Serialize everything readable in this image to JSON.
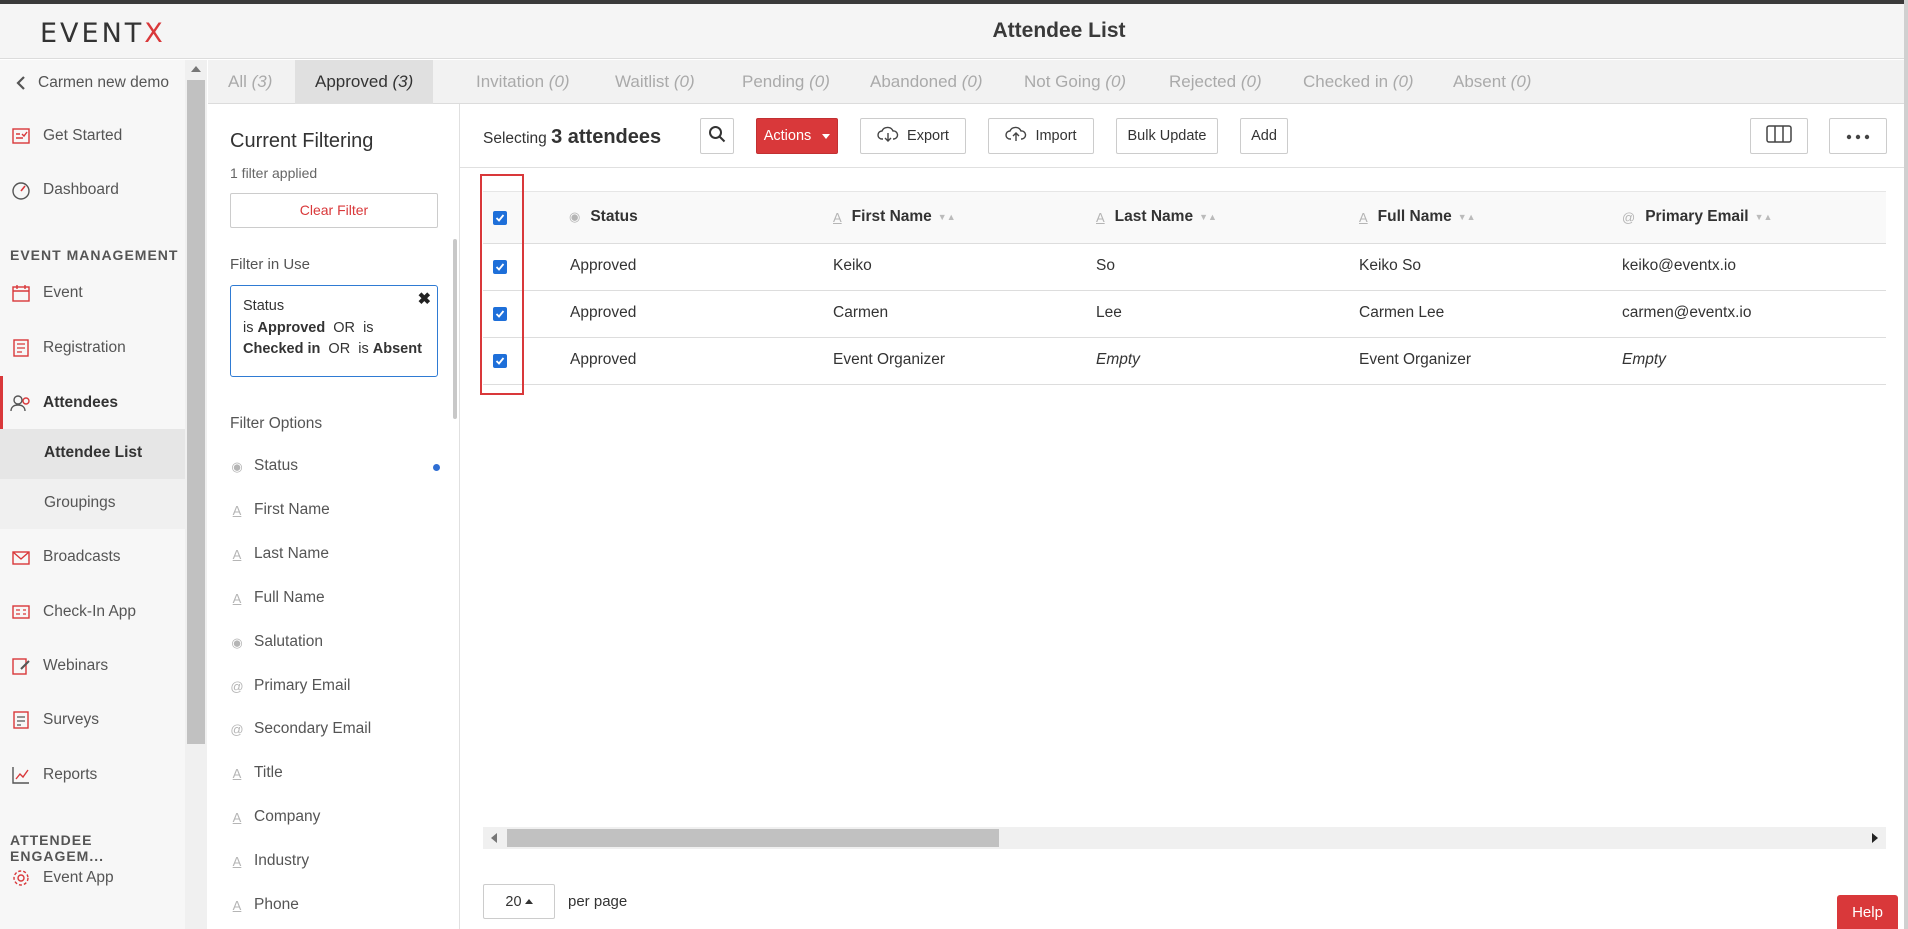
{
  "header": {
    "logo_main": "EVENT",
    "logo_x": "X",
    "title": "Attendee List"
  },
  "sidebar": {
    "back_label": "Carmen new demo",
    "items_top": [
      {
        "label": "Get Started",
        "icon": "checklist-icon"
      },
      {
        "label": "Dashboard",
        "icon": "gauge-icon"
      }
    ],
    "section_event": "EVENT MANAGEMENT",
    "items_event": [
      {
        "label": "Event",
        "icon": "calendar-icon"
      },
      {
        "label": "Registration",
        "icon": "form-icon"
      },
      {
        "label": "Attendees",
        "icon": "people-icon"
      }
    ],
    "sub_items": [
      {
        "label": "Attendee List",
        "active": true
      },
      {
        "label": "Groupings",
        "active": false
      }
    ],
    "items_more": [
      {
        "label": "Broadcasts",
        "icon": "envelope-icon"
      },
      {
        "label": "Check-In App",
        "icon": "id-card-icon"
      },
      {
        "label": "Webinars",
        "icon": "edit-icon"
      },
      {
        "label": "Surveys",
        "icon": "survey-icon"
      },
      {
        "label": "Reports",
        "icon": "chart-icon"
      }
    ],
    "section_engagement": "ATTENDEE ENGAGEM...",
    "items_engagement": [
      {
        "label": "Event App",
        "icon": "gear-icon"
      }
    ]
  },
  "tabs": [
    {
      "label": "All",
      "count": "(3)"
    },
    {
      "label": "Approved",
      "count": "(3)"
    },
    {
      "label": "Invitation",
      "count": "(0)"
    },
    {
      "label": "Waitlist",
      "count": "(0)"
    },
    {
      "label": "Pending",
      "count": "(0)"
    },
    {
      "label": "Abandoned",
      "count": "(0)"
    },
    {
      "label": "Not Going",
      "count": "(0)"
    },
    {
      "label": "Rejected",
      "count": "(0)"
    },
    {
      "label": "Checked in",
      "count": "(0)"
    },
    {
      "label": "Absent",
      "count": "(0)"
    }
  ],
  "filter": {
    "title": "Current Filtering",
    "applied": "1 filter applied",
    "clear_label": "Clear Filter",
    "in_use_label": "Filter in Use",
    "rule": {
      "field": "Status",
      "is1": "is",
      "v1": "Approved",
      "or1": "OR",
      "is2": "is",
      "v2": "Checked in",
      "or2": "OR",
      "is3": "is",
      "v3": "Absent",
      "close": "✖"
    },
    "options_label": "Filter Options",
    "options": [
      {
        "label": "Status",
        "icon": "radio-icon",
        "active": true
      },
      {
        "label": "First Name",
        "icon": "text-icon"
      },
      {
        "label": "Last Name",
        "icon": "text-icon"
      },
      {
        "label": "Full Name",
        "icon": "text-icon"
      },
      {
        "label": "Salutation",
        "icon": "radio-icon"
      },
      {
        "label": "Primary Email",
        "icon": "at-icon"
      },
      {
        "label": "Secondary Email",
        "icon": "at-icon"
      },
      {
        "label": "Title",
        "icon": "text-icon"
      },
      {
        "label": "Company",
        "icon": "text-icon"
      },
      {
        "label": "Industry",
        "icon": "text-icon"
      },
      {
        "label": "Phone",
        "icon": "text-icon"
      }
    ]
  },
  "toolbar": {
    "selecting_label": "Selecting",
    "selecting_count": "3 attendees",
    "actions_label": "Actions",
    "export_label": "Export",
    "import_label": "Import",
    "bulk_update_label": "Bulk Update",
    "add_label": "Add"
  },
  "table": {
    "columns": [
      "Status",
      "First Name",
      "Last Name",
      "Full Name",
      "Primary Email"
    ],
    "rows": [
      [
        "Approved",
        "Keiko",
        "So",
        "Keiko So",
        "keiko@eventx.io"
      ],
      [
        "Approved",
        "Carmen",
        "Lee",
        "Carmen Lee",
        "carmen@eventx.io"
      ],
      [
        "Approved",
        "Event Organizer",
        "Empty",
        "Event Organizer",
        "Empty"
      ]
    ]
  },
  "pagination": {
    "per_page_value": "20",
    "per_page_label": "per page"
  },
  "help_label": "Help",
  "colors": {
    "accent": "#d9383a",
    "checkbox": "#1e6fd9",
    "filter_border": "#2f7bd3"
  }
}
